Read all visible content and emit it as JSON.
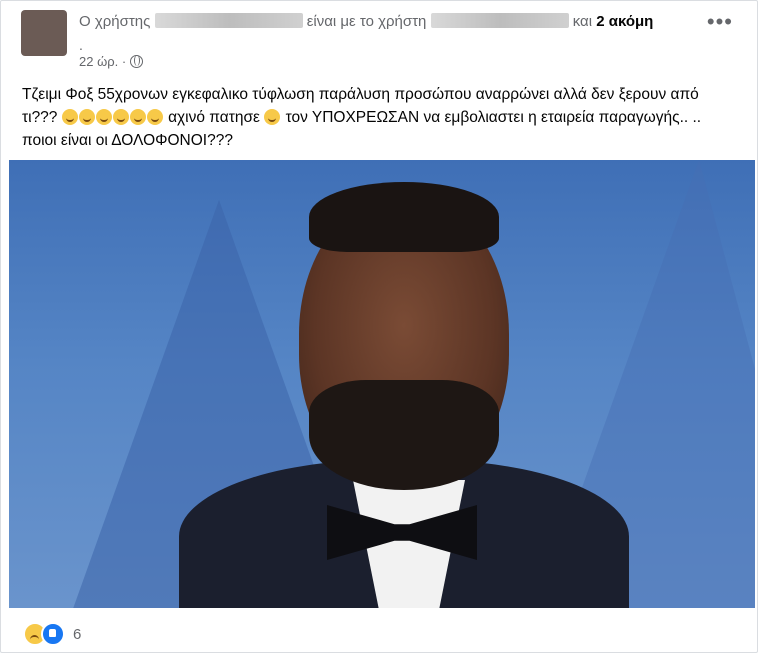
{
  "post": {
    "header": {
      "prefix": "Ο χρήστης",
      "middle": "είναι με το χρήστη",
      "connector": "και",
      "others": "2 ακόμη",
      "trailing_dot": "."
    },
    "time": "22 ώρ. ·",
    "privacy_icon": "globe-icon",
    "more_label": "•••",
    "text_parts": [
      "Τζειμι Φοξ 55χρονων εγκεφαλικο τύφλωση παράλυση προσώπου αναρρώνει αλλά δεν ξερουν από τι???",
      "αχινό πατησε",
      "τον ΥΠΟΧΡΕΩΣΑΝ να εμβολιαστει η εταιρεία παραγωγής.. .. ποιοι είναι οι ΔΟΛΟΦΟΝΟΙ???"
    ],
    "emoji_icons": [
      "winking-tongue-emoji",
      "rofl-emoji"
    ],
    "reactions": {
      "icons": [
        "sad-reaction-icon",
        "like-reaction-icon"
      ],
      "count": "6"
    }
  },
  "colors": {
    "secondary_text": "#65676b",
    "like_blue": "#1877f2",
    "border": "#dadde1"
  }
}
